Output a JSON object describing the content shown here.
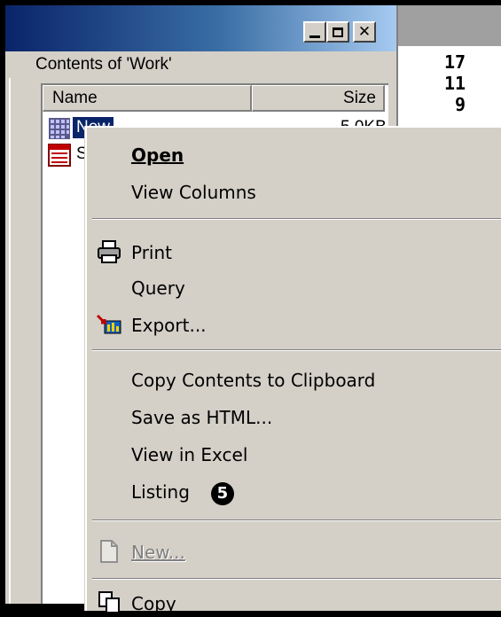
{
  "window": {
    "contents_label": "Contents of 'Work'",
    "title_buttons": {
      "minimize": "_",
      "maximize": "□",
      "close": "✕"
    }
  },
  "list": {
    "columns": [
      "Name",
      "Size"
    ],
    "rows": [
      {
        "name": "New",
        "size": "5.0KB",
        "icon": "grid-file-icon",
        "selected": true
      },
      {
        "name": "S",
        "size": "",
        "icon": "spreadsheet-file-icon",
        "selected": false
      }
    ]
  },
  "right_pane": {
    "values": [
      "17",
      "11",
      "9"
    ]
  },
  "context_menu": {
    "items": [
      {
        "label": "Open",
        "bold": true
      },
      {
        "label": "View Columns"
      },
      {
        "label": "Print",
        "icon": "printer-icon"
      },
      {
        "label": "Query"
      },
      {
        "label": "Export...",
        "icon": "export-icon"
      },
      {
        "label": "Copy Contents to Clipboard"
      },
      {
        "label": "Save as HTML..."
      },
      {
        "label": "View in Excel"
      },
      {
        "label": "Listing",
        "badge": "5"
      },
      {
        "label": "New...",
        "disabled": true,
        "icon": "new-document-icon"
      },
      {
        "label": "Copy",
        "icon": "copy-icon"
      }
    ]
  },
  "colors": {
    "title_start": "#0a246a",
    "title_end": "#a6caf0",
    "selection": "#0a246a",
    "face": "#d4d0c8"
  }
}
